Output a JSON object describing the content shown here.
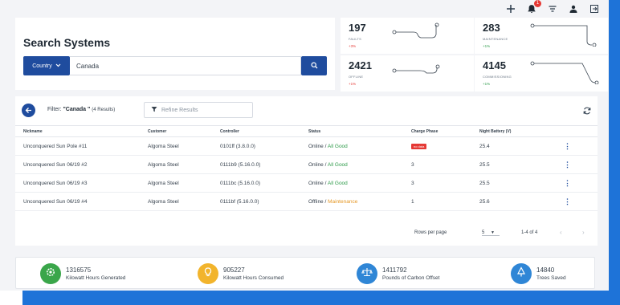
{
  "topbar": {
    "icons": [
      "plus-icon",
      "notification-bell-icon",
      "filter-icon",
      "user-icon",
      "logout-icon"
    ],
    "notification_count": "1"
  },
  "search": {
    "title": "Search Systems",
    "country_label": "Country",
    "query": "Canada"
  },
  "stats": [
    {
      "value": "197",
      "label": "FAULTS",
      "change": "+3%",
      "trend": "down"
    },
    {
      "value": "283",
      "label": "MAINTENANCE",
      "change": "+1%",
      "trend": "up"
    },
    {
      "value": "2421",
      "label": "OFFLINE",
      "change": "+1%",
      "trend": "down"
    },
    {
      "value": "4145",
      "label": "COMMISSIONING",
      "change": "+1%",
      "trend": "up"
    }
  ],
  "results": {
    "filter_prefix": "Filter:",
    "filter_value": "\"Canada \"",
    "filter_count": "(4 Results)",
    "refine_placeholder": "Refine Results",
    "columns": [
      "Nickname",
      "Customer",
      "Controller",
      "Status",
      "Charge Phase",
      "Night Battery (V)"
    ],
    "rows": [
      {
        "nickname": "Unconquered Sun Pole #11",
        "customer": "Algoma Steel",
        "controller": "0101ff (3.8.0.0)",
        "status_state": "Online",
        "status_health": "All Good",
        "health_kind": "ok",
        "charge_phase": "no data",
        "charge_is_badge": true,
        "night_battery": "25.4"
      },
      {
        "nickname": "Unconquered Sun 06/19 #2",
        "customer": "Algoma Steel",
        "controller": "0111b9 (5.16.0.0)",
        "status_state": "Online",
        "status_health": "All Good",
        "health_kind": "ok",
        "charge_phase": "3",
        "charge_is_badge": false,
        "night_battery": "25.5"
      },
      {
        "nickname": "Unconquered Sun 06/19 #3",
        "customer": "Algoma Steel",
        "controller": "0111bc (5.16.0.0)",
        "status_state": "Online",
        "status_health": "All Good",
        "health_kind": "ok",
        "charge_phase": "3",
        "charge_is_badge": false,
        "night_battery": "25.5"
      },
      {
        "nickname": "Unconquered Sun 06/19 #4",
        "customer": "Algoma Steel",
        "controller": "0111bf (5.16.0.0)",
        "status_state": "Offline",
        "status_health": "Maintenance",
        "health_kind": "warn",
        "charge_phase": "1",
        "charge_is_badge": false,
        "night_battery": "25.6"
      }
    ],
    "pagination": {
      "rows_per_page_label": "Rows per page",
      "rows_per_page": "5",
      "range": "1-4 of 4"
    }
  },
  "totals": [
    {
      "value": "1316575",
      "label": "Kilowatt Hours Generated",
      "icon": "gear-icon",
      "color": "#3aa64a"
    },
    {
      "value": "905227",
      "label": "Kilowatt Hours Consumed",
      "icon": "lightbulb-icon",
      "color": "#f2b42c"
    },
    {
      "value": "1411792",
      "label": "Pounds of Carbon Offset",
      "icon": "scale-icon",
      "color": "#2f86d6"
    },
    {
      "value": "14840",
      "label": "Trees Saved",
      "icon": "tree-icon",
      "color": "#2f86d6"
    }
  ],
  "colors": {
    "accent": "#1f4c9e",
    "good": "#2e9b4a",
    "warning": "#e59826",
    "fault": "#e53935"
  }
}
